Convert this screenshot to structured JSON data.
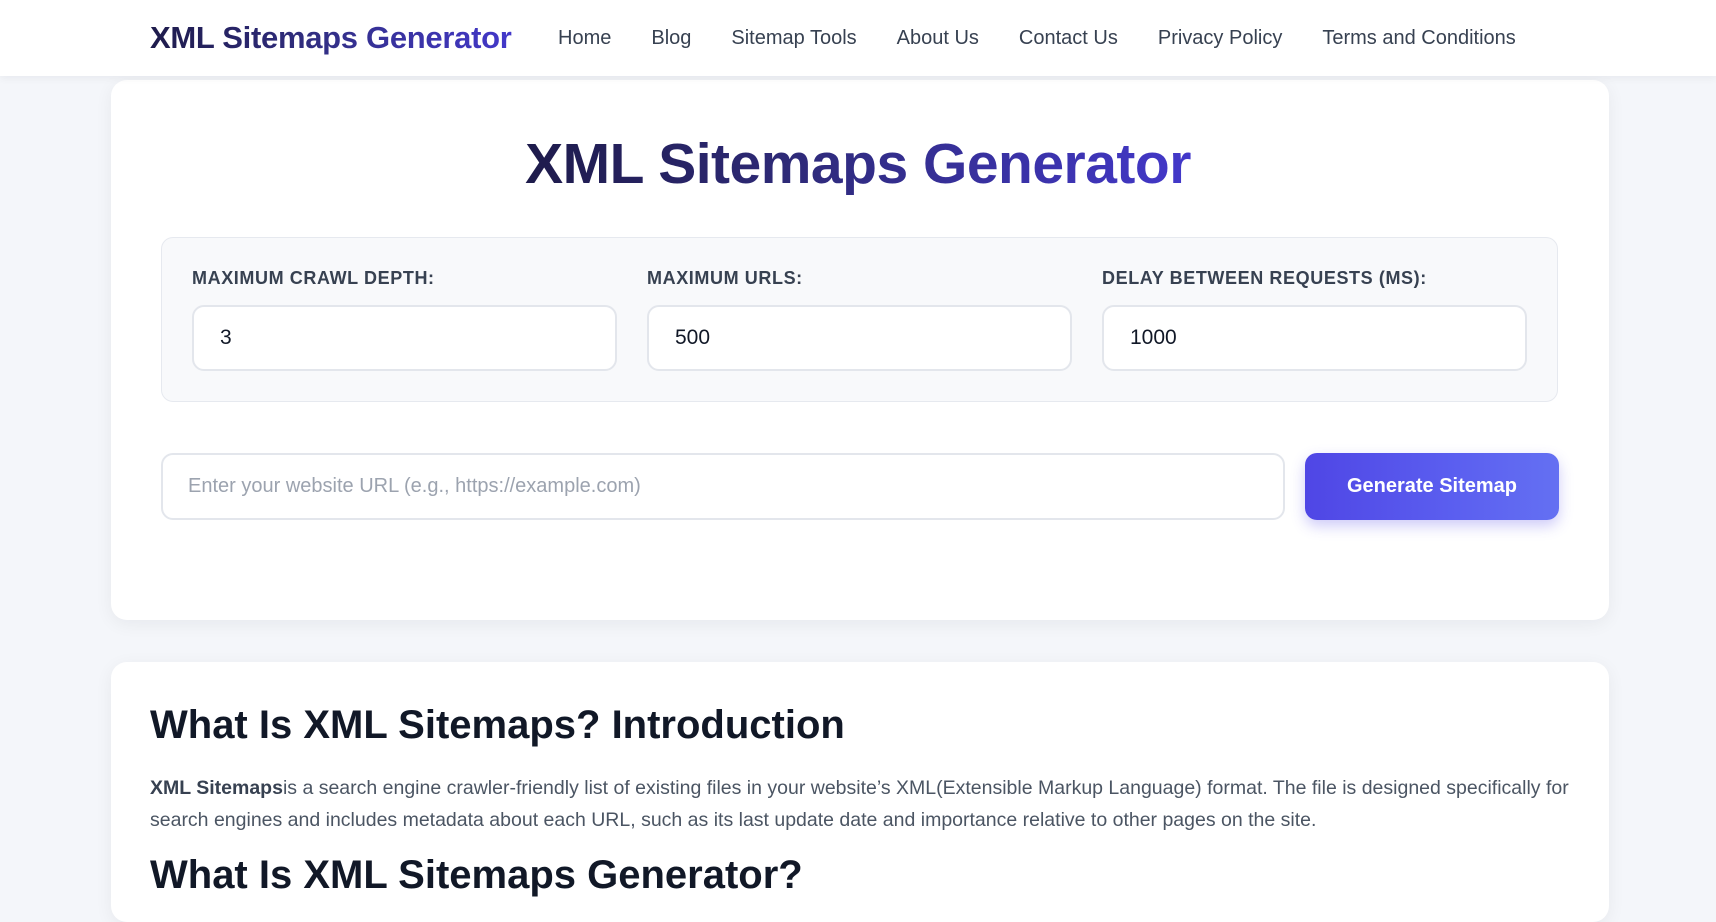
{
  "header": {
    "brand": "XML Sitemaps Generator",
    "nav": [
      {
        "label": "Home"
      },
      {
        "label": "Blog"
      },
      {
        "label": "Sitemap Tools"
      },
      {
        "label": "About Us"
      },
      {
        "label": "Contact Us"
      },
      {
        "label": "Privacy Policy"
      },
      {
        "label": "Terms and Conditions"
      }
    ]
  },
  "main": {
    "title": "XML Sitemaps Generator",
    "settings": {
      "crawl_depth": {
        "label": "MAXIMUM CRAWL DEPTH:",
        "value": "3"
      },
      "max_urls": {
        "label": "MAXIMUM URLS:",
        "value": "500"
      },
      "delay": {
        "label": "DELAY BETWEEN REQUESTS (MS):",
        "value": "1000"
      }
    },
    "url_input": {
      "placeholder": "Enter your website URL (e.g., https://example.com)",
      "value": ""
    },
    "generate_label": "Generate Sitemap"
  },
  "intro": {
    "title": "What Is XML Sitemaps? Introduction",
    "bold": "XML Sitemaps",
    "text": "is a search engine crawler-friendly list of existing files in your website’s XML(Extensible Markup Language) format. The file is designed specifically for search engines and includes metadata about each URL, such as its last update date and importance relative to other pages on the site.",
    "next_title": "What Is XML Sitemaps Generator?"
  },
  "colors": {
    "accent": "#4f46e5",
    "title_dark": "#1e1b4b",
    "title_light": "#4338ca",
    "background": "#f4f6fa"
  }
}
